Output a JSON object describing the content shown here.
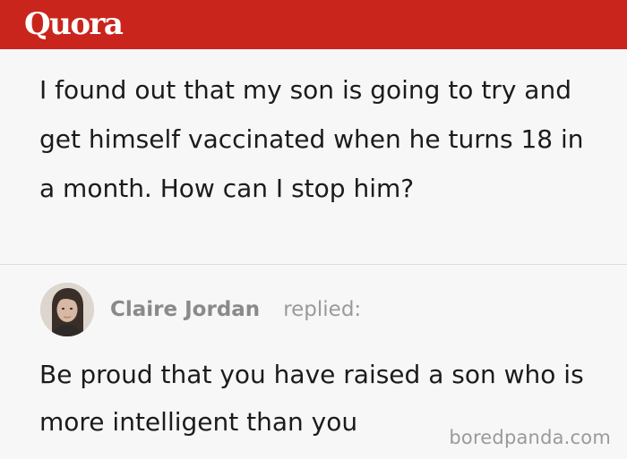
{
  "header": {
    "logo_text": "Quora",
    "brand_color": "#c9251c"
  },
  "question": {
    "text": "I found out that my son is going to try and get himself vaccinated when he turns 18 in a month. How can I stop him?"
  },
  "answer": {
    "author_name": "Claire Jordan",
    "reply_verb": "replied:",
    "avatar_icon": "user-photo",
    "text": "Be proud that you have raised a son who is more intelligent than you"
  },
  "watermark": {
    "text": "boredpanda.com"
  }
}
